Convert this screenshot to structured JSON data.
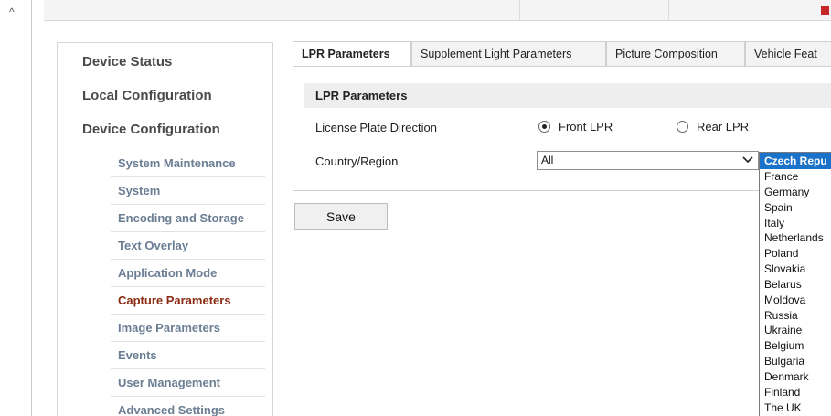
{
  "sidebar": {
    "top_items": [
      {
        "label": "Device Status"
      },
      {
        "label": "Local Configuration"
      },
      {
        "label": "Device Configuration"
      }
    ],
    "sub_items": [
      {
        "label": "System Maintenance"
      },
      {
        "label": "System"
      },
      {
        "label": "Encoding and Storage"
      },
      {
        "label": "Text Overlay"
      },
      {
        "label": "Application Mode"
      },
      {
        "label": "Capture Parameters"
      },
      {
        "label": "Image Parameters"
      },
      {
        "label": "Events"
      },
      {
        "label": "User Management"
      },
      {
        "label": "Advanced Settings"
      }
    ],
    "active_sub": "Capture Parameters"
  },
  "tabs": [
    {
      "label": "LPR Parameters",
      "active": true
    },
    {
      "label": "Supplement Light Parameters",
      "active": false
    },
    {
      "label": "Picture Composition",
      "active": false
    },
    {
      "label": "Vehicle Feat",
      "active": false
    }
  ],
  "section": {
    "title": "LPR Parameters",
    "plate_direction": {
      "label": "License Plate Direction",
      "options": [
        {
          "label": "Front LPR",
          "checked": true
        },
        {
          "label": "Rear LPR",
          "checked": false
        }
      ]
    },
    "country": {
      "label": "Country/Region",
      "value": "All"
    }
  },
  "save_label": "Save",
  "dropdown_list": [
    "Czech Repu",
    "France",
    "Germany",
    "Spain",
    "Italy",
    "Netherlands",
    "Poland",
    "Slovakia",
    "Belarus",
    "Moldova",
    "Russia",
    "Ukraine",
    "Belgium",
    "Bulgaria",
    "Denmark",
    "Finland",
    "The UK"
  ],
  "dropdown_selected_index": 0,
  "colors": {
    "accent_selected": "#1a73c9",
    "active_nav": "#8b2b12",
    "nav_sub": "#6b7e93"
  },
  "icons": {
    "collapse": "chevron-up-icon",
    "select": "chevron-down-icon"
  }
}
